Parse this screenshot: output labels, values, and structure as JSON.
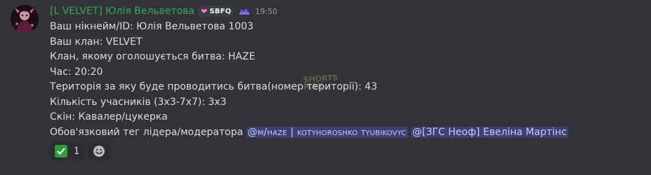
{
  "message": {
    "author": {
      "display_name": "[L VELVET] Юлія Вельветова",
      "clan_tag": "SBFQ",
      "clan_tag_icon": "heart-badge-icon",
      "role_icon": "role-icon"
    },
    "timestamp": "19:50",
    "lines": [
      "Ваш нікнейм/ID: Юлія Вельветова 1003",
      "Ваш клан: VELVET",
      "Клан, якому оголошується битва: HAZE",
      "Час: 20:20",
      "Територія за яку буде проводитись битва(номер території): 43",
      "Кількість учасників (3х3-7х7): 3х3",
      "Скін: Кавалер/цукерка"
    ],
    "last_line_prefix": "Обов'язковий тег лідера/модератора",
    "mentions": [
      "@м/haze | kotyhoroshko tyubikovyc",
      "@[ЗГС Неоф] Евеліна Мартінс"
    ],
    "watermark": "SHORTS\nMAX",
    "reactions": [
      {
        "emoji": "check-mark-icon",
        "count": "1",
        "color": "#2e9e3d"
      }
    ],
    "add_reaction_icon": "add-reaction-icon"
  },
  "colors": {
    "background": "#323339",
    "username": "#3ba55c",
    "mention_bg": "#3f4776",
    "mention_text": "#c9cdfb",
    "timestamp": "#949ba4"
  }
}
